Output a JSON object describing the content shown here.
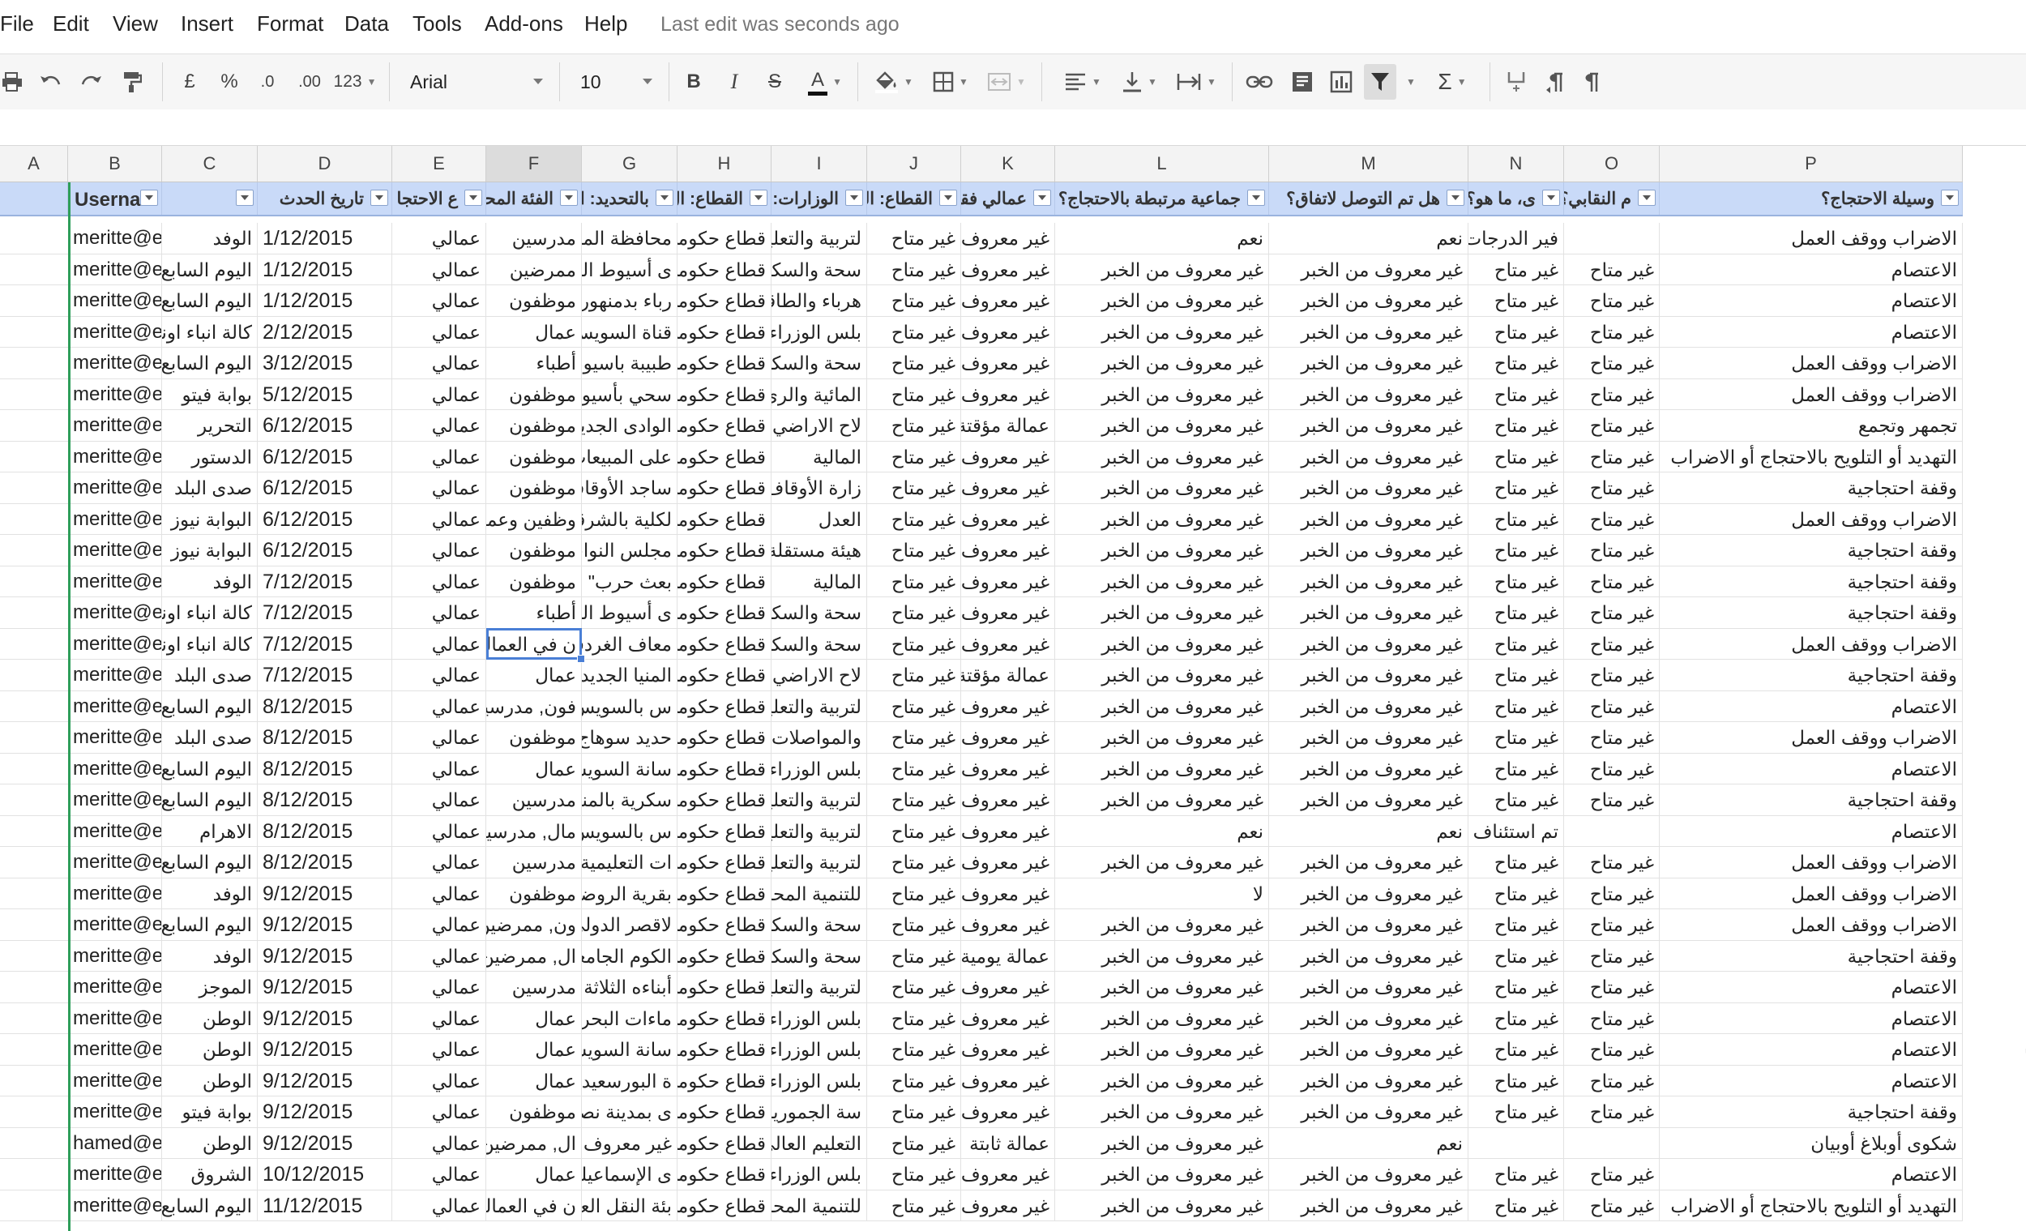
{
  "menu": [
    "File",
    "Edit",
    "View",
    "Insert",
    "Format",
    "Data",
    "Tools",
    "Add-ons",
    "Help"
  ],
  "status": "Last edit was seconds ago",
  "toolbar": {
    "currency": "£",
    "percent": "%",
    "dec_less": ".0",
    "dec_more": ".00",
    "format_more": "123",
    "font": "Arial",
    "size": "10",
    "bold": "B",
    "italic": "I",
    "strike": "S",
    "textcolor": "A",
    "sum": "Σ",
    "icons": [
      "printer-icon",
      "undo-icon",
      "redo-icon",
      "paint-format-icon",
      "fill-color-icon",
      "borders-icon",
      "merge-icon",
      "align-icon",
      "valign-icon",
      "text-wrap-icon",
      "link-icon",
      "comment-icon",
      "chart-icon",
      "filter-icon",
      "functions-icon",
      "rtl-icon",
      "ltr-icon"
    ]
  },
  "colors": {
    "header_fill": "#c9daf8",
    "selection": "#4a7fd6",
    "frozen_line": "#2e9e5a",
    "active_col": "#dcdcdc"
  },
  "columns": [
    "A",
    "B",
    "C",
    "D",
    "E",
    "F",
    "G",
    "H",
    "I",
    "J",
    "K",
    "L",
    "M",
    "N",
    "O",
    "P"
  ],
  "selected_column": "F",
  "header": [
    "",
    "Userna",
    "",
    "تاريخ الحدث",
    "ع الاحتجا",
    "الفئة المحت",
    "بالتحديد: ا",
    "القطاع: ال",
    "الوزارات: ا",
    "القطاع: الد",
    "عمالي فقط",
    "جماعية مرتبطة بالاحتجاج؟",
    "هل تم التوصل لاتفاق؟",
    "ى، ما هو؟",
    "م النقابي؟",
    "وسيلة الاحتجاج؟"
  ],
  "rows": [
    [
      "",
      "meritte@e",
      "الوفد",
      "1/12/2015",
      "عمالي",
      "مدرسين",
      "محافظة المنيا",
      "قطاع حكومي",
      "لتربية والتعليم",
      "غير متاح",
      "غير معروف",
      "نعم",
      "نعم",
      "فير الدرجات المالية للمعلمين",
      "",
      "الاضراب ووقف العمل"
    ],
    [
      "",
      "meritte@e",
      "اليوم السابع",
      "1/12/2015",
      "عمالي",
      "ممرضين",
      "ى أسيوط العام",
      "قطاع حكومي",
      "سحة والسكان",
      "غير متاح",
      "غير معروف",
      "غير معروف من الخبر",
      "غير معروف من الخبر",
      "غير متاح",
      "غير متاح",
      "الاعتصام"
    ],
    [
      "",
      "meritte@e",
      "اليوم السابع",
      "1/12/2015",
      "عمالي",
      "موظفون",
      "رباء بدمنهور",
      "قطاع حكومي",
      "هرباء والطاقة",
      "غير متاح",
      "غير معروف",
      "غير معروف من الخبر",
      "غير معروف من الخبر",
      "غير متاح",
      "غير متاح",
      "الاعتصام"
    ],
    [
      "",
      "meritte@e",
      "كالة انباء اونا",
      "2/12/2015",
      "عمالي",
      "عمال",
      "قناة السويس",
      "قطاع حكومي",
      "بلس الوزراء",
      "غير متاح",
      "غير معروف",
      "غير معروف من الخبر",
      "غير معروف من الخبر",
      "غير متاح",
      "غير متاح",
      "الاعتصام"
    ],
    [
      "",
      "meritte@e",
      "اليوم السابع",
      "3/12/2015",
      "عمالي",
      "أطباء",
      "طبيبة باسيوط",
      "قطاع حكومي",
      "سحة والسكان",
      "غير متاح",
      "غير معروف",
      "غير معروف من الخبر",
      "غير معروف من الخبر",
      "غير متاح",
      "غير متاح",
      "الاضراب ووقف العمل"
    ],
    [
      "",
      "meritte@e",
      "بوابة فيتو",
      "5/12/2015",
      "عمالي",
      "موظفون",
      "سحي بأسيوط",
      "قطاع حكومي",
      "المائية والري",
      "غير متاح",
      "غير معروف",
      "غير معروف من الخبر",
      "غير معروف من الخبر",
      "غير متاح",
      "غير متاح",
      "الاضراب ووقف العمل"
    ],
    [
      "",
      "meritte@e",
      "التحرير",
      "6/12/2015",
      "عمالي",
      "موظفون",
      "الوادى الجديد",
      "قطاع حكومي",
      "لاح الاراضي",
      "غير متاح",
      "عمالة مؤقتة",
      "غير معروف من الخبر",
      "غير معروف من الخبر",
      "غير متاح",
      "غير متاح",
      "تجمهر وتجمع"
    ],
    [
      "",
      "meritte@e",
      "الدستور",
      "6/12/2015",
      "عمالي",
      "موظفون",
      "على المبيعات",
      "قطاع حكومي",
      "المالية",
      "غير متاح",
      "غير معروف",
      "غير معروف من الخبر",
      "غير معروف من الخبر",
      "غير متاح",
      "غير متاح",
      "التهديد أو التلويح بالاحتجاج أو الاضراب"
    ],
    [
      "",
      "meritte@e",
      "صدى البلد",
      "6/12/2015",
      "عمالي",
      "موظفون",
      "ساجد الأوقاف",
      "قطاع حكومي",
      "زارة الأوقاف",
      "غير متاح",
      "غير معروف",
      "غير معروف من الخبر",
      "غير معروف من الخبر",
      "غير متاح",
      "غير متاح",
      "وقفة احتجاجية"
    ],
    [
      "",
      "meritte@e",
      "البوابة نيوز",
      "6/12/2015",
      "عمالي",
      "وظفين وعمال",
      "لكلية بالشرقية",
      "قطاع حكومي",
      "العدل",
      "غير متاح",
      "غير معروف",
      "غير معروف من الخبر",
      "غير معروف من الخبر",
      "غير متاح",
      "غير متاح",
      "الاضراب ووقف العمل"
    ],
    [
      "",
      "meritte@e",
      "البوابة نيوز",
      "6/12/2015",
      "عمالي",
      "موظفون",
      "مجلس النواب",
      "قطاع حكومي",
      "هيئة مستقلة",
      "غير متاح",
      "غير معروف",
      "غير معروف من الخبر",
      "غير معروف من الخبر",
      "غير متاح",
      "غير متاح",
      "وقفة احتجاجية"
    ],
    [
      "",
      "meritte@e",
      "الوفد",
      "7/12/2015",
      "عمالي",
      "موظفون",
      "بعث حرب\" و",
      "قطاع حكومي",
      "المالية",
      "غير متاح",
      "غير معروف",
      "غير معروف من الخبر",
      "غير معروف من الخبر",
      "غير متاح",
      "غير متاح",
      "وقفة احتجاجية"
    ],
    [
      "",
      "meritte@e",
      "كالة انباء اونا",
      "7/12/2015",
      "عمالي",
      "أطباء",
      "ى أسيوط العام",
      "قطاع حكومي",
      "سحة والسكان",
      "غير متاح",
      "غير معروف",
      "غير معروف من الخبر",
      "غير معروف من الخبر",
      "غير متاح",
      "غير متاح",
      "وقفة احتجاجية"
    ],
    [
      "",
      "meritte@e",
      "كالة انباء اونا",
      "7/12/2015",
      "عمالي",
      "ن في العمالي",
      "معاف الغردقة",
      "قطاع حكومي",
      "سحة والسكان",
      "غير متاح",
      "غير معروف",
      "غير معروف من الخبر",
      "غير معروف من الخبر",
      "غير متاح",
      "غير متاح",
      "الاضراب ووقف العمل"
    ],
    [
      "",
      "meritte@e",
      "صدى البلد",
      "7/12/2015",
      "عمالي",
      "عمال",
      "المنيا الجديدة",
      "قطاع حكومي",
      "لاح الاراضي",
      "غير متاح",
      "عمالة مؤقتة",
      "غير معروف من الخبر",
      "غير معروف من الخبر",
      "غير متاح",
      "غير متاح",
      "وقفة احتجاجية"
    ],
    [
      "",
      "meritte@e",
      "اليوم السابع",
      "8/12/2015",
      "عمالي",
      "فون, مدرسين",
      "س بالسويس",
      "قطاع حكومي",
      "لتربية والتعليم",
      "غير متاح",
      "غير معروف",
      "غير معروف من الخبر",
      "غير معروف من الخبر",
      "غير متاح",
      "غير متاح",
      "الاعتصام"
    ],
    [
      "",
      "meritte@e",
      "صدى البلد",
      "8/12/2015",
      "عمالي",
      "موظفون",
      "حديد سوهاج",
      "قطاع حكومي",
      "والمواصلات",
      "غير متاح",
      "غير معروف",
      "غير معروف من الخبر",
      "غير معروف من الخبر",
      "غير متاح",
      "غير متاح",
      "الاضراب ووقف العمل"
    ],
    [
      "",
      "meritte@e",
      "اليوم السابع",
      "8/12/2015",
      "عمالي",
      "عمال",
      "سانة السويس",
      "قطاع حكومي",
      "بلس الوزراء",
      "غير متاح",
      "غير معروف",
      "غير معروف من الخبر",
      "غير معروف من الخبر",
      "غير متاح",
      "غير متاح",
      "الاعتصام"
    ],
    [
      "",
      "meritte@e",
      "اليوم السابع",
      "8/12/2015",
      "عمالي",
      "مدرسين",
      "سكرية بالمنيا",
      "قطاع حكومي",
      "لتربية والتعليم",
      "غير متاح",
      "غير معروف",
      "غير معروف من الخبر",
      "غير معروف من الخبر",
      "غير متاح",
      "غير متاح",
      "وقفة احتجاجية"
    ],
    [
      "",
      "meritte@e",
      "الاهرام",
      "8/12/2015",
      "عمالي",
      "مال, مدرسين",
      "س بالسويس",
      "قطاع حكومي",
      "لتربية والتعليم",
      "غير متاح",
      "غير معروف",
      "نعم",
      "نعم",
      "تم استئناف العمل بالمدرسة.",
      "",
      "الاعتصام"
    ],
    [
      "",
      "meritte@e",
      "اليوم السابع",
      "8/12/2015",
      "عمالي",
      "مدرسين",
      "ات التعليمية",
      "قطاع حكومي",
      "لتربية والتعليم",
      "غير متاح",
      "غير معروف",
      "غير معروف من الخبر",
      "غير معروف من الخبر",
      "غير متاح",
      "غير متاح",
      "الاضراب ووقف العمل"
    ],
    [
      "",
      "meritte@e",
      "الوفد",
      "9/12/2015",
      "عمالي",
      "موظفون",
      "بقرية الروضا",
      "قطاع حكومي",
      "للتنمية المحلية",
      "غير متاح",
      "غير معروف",
      "لا",
      "غير معروف من الخبر",
      "غير متاح",
      "غير متاح",
      "الاضراب ووقف العمل"
    ],
    [
      "",
      "meritte@e",
      "اليوم السابع",
      "9/12/2015",
      "عمالي",
      "ون, ممرضين",
      "لاقصر الدولي",
      "قطاع حكومي",
      "سحة والسكان",
      "غير متاح",
      "غير معروف",
      "غير معروف من الخبر",
      "غير معروف من الخبر",
      "غير متاح",
      "غير متاح",
      "الاضراب ووقف العمل"
    ],
    [
      "",
      "meritte@e",
      "الوفد",
      "9/12/2015",
      "عمالي",
      "ال, ممرضين",
      "الكوم الجامعي",
      "قطاع حكومي",
      "سحة والسكان",
      "غير متاح",
      "عمالة يومية",
      "غير معروف من الخبر",
      "غير معروف من الخبر",
      "غير متاح",
      "غير متاح",
      "وقفة احتجاجية"
    ],
    [
      "",
      "meritte@e",
      "الموجز",
      "9/12/2015",
      "عمالي",
      "مدرسين",
      "أبناءه الثلاثة",
      "قطاع حكومي",
      "لتربية والتعليم",
      "غير متاح",
      "غير معروف",
      "غير معروف من الخبر",
      "غير معروف من الخبر",
      "غير متاح",
      "غير متاح",
      "الاعتصام"
    ],
    [
      "",
      "meritte@e",
      "الوطن",
      "9/12/2015",
      "عمالي",
      "عمال",
      "ماءات البحرية",
      "قطاع حكومي",
      "بلس الوزراء",
      "غير متاح",
      "غير معروف",
      "غير معروف من الخبر",
      "غير معروف من الخبر",
      "غير متاح",
      "غير متاح",
      "الاعتصام"
    ],
    [
      "",
      "meritte@e",
      "الوطن",
      "9/12/2015",
      "عمالي",
      "عمال",
      "سانة السويس",
      "قطاع حكومي",
      "بلس الوزراء",
      "غير متاح",
      "غير معروف",
      "غير معروف من الخبر",
      "غير معروف من الخبر",
      "غير متاح",
      "غير متاح",
      "الاعتصام"
    ],
    [
      "",
      "meritte@e",
      "الوطن",
      "9/12/2015",
      "عمالي",
      "عمال",
      "ة البورسعيدية",
      "قطاع حكومي",
      "بلس الوزراء",
      "غير متاح",
      "غير معروف",
      "غير معروف من الخبر",
      "غير معروف من الخبر",
      "غير متاح",
      "غير متاح",
      "الاعتصام"
    ],
    [
      "",
      "meritte@e",
      "بوابة فيتو",
      "9/12/2015",
      "عمالي",
      "موظفون",
      "ى بمدينة نصر",
      "قطاع حكومي",
      "سة الجمورية",
      "غير متاح",
      "غير معروف",
      "غير معروف من الخبر",
      "غير معروف من الخبر",
      "غير متاح",
      "غير متاح",
      "وقفة احتجاجية"
    ],
    [
      "",
      "hamed@e",
      "الوطن",
      "9/12/2015",
      "عمالي",
      "ال, ممرضين",
      "غير معروف",
      "قطاع حكومي",
      "التعليم العالي",
      "غير متاح",
      "عمالة ثابتة",
      "غير معروف من الخبر",
      "نعم",
      "",
      "",
      "شكوى أوبلاغ أوبيان"
    ],
    [
      "",
      "meritte@e",
      "الشروق",
      "10/12/2015",
      "عمالي",
      "عمال",
      "ى الإسماعيلية",
      "قطاع حكومي",
      "بلس الوزراء",
      "غير متاح",
      "غير معروف",
      "غير معروف من الخبر",
      "غير معروف من الخبر",
      "غير متاح",
      "غير متاح",
      "الاعتصام"
    ],
    [
      "",
      "meritte@e",
      "اليوم السابع",
      "11/12/2015",
      "عمالي",
      "ن في العمالي",
      "بئة النقل العام",
      "قطاع حكومي",
      "للتنمية المحلية",
      "غير متاح",
      "غير معروف",
      "غير معروف من الخبر",
      "غير معروف من الخبر",
      "غير متاح",
      "غير متاح",
      "التهديد أو التلويح بالاحتجاج أو الاضراب"
    ]
  ],
  "overflow_text": "ام"
}
